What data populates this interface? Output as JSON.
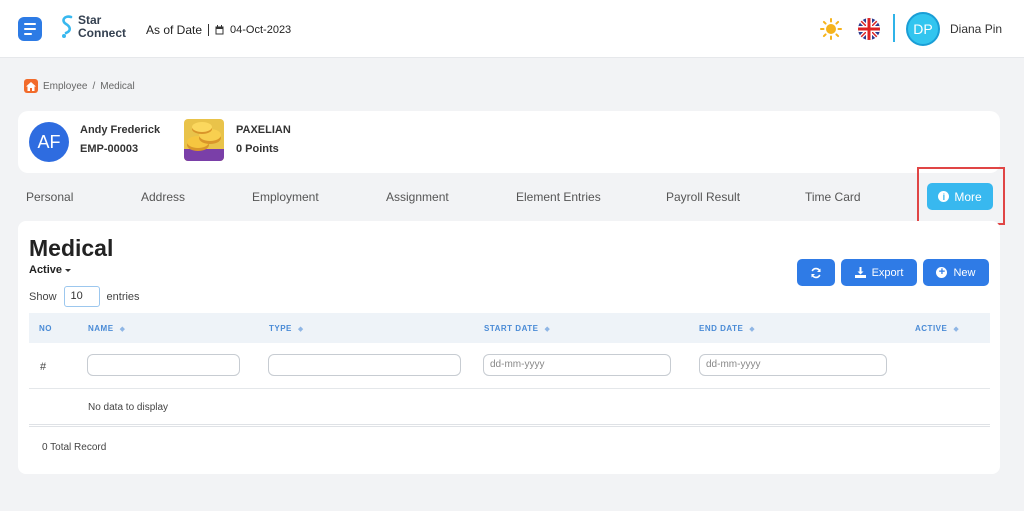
{
  "header": {
    "logo_line1": "Star",
    "logo_line2": "Connect",
    "as_of_label": "As of Date",
    "as_of_date": "04-Oct-2023",
    "user_initials": "DP",
    "user_name": "Diana Pin"
  },
  "breadcrumb": {
    "root": "Employee",
    "separator": "/",
    "current": "Medical"
  },
  "profile": {
    "initials": "AF",
    "name": "Andy Frederick",
    "employee_id": "EMP-00003",
    "reward_name": "PAXELIAN",
    "reward_points": "0 Points"
  },
  "tabs": [
    {
      "label": "Personal"
    },
    {
      "label": "Address"
    },
    {
      "label": "Employment"
    },
    {
      "label": "Assignment"
    },
    {
      "label": "Element Entries"
    },
    {
      "label": "Payroll Result"
    },
    {
      "label": "Time Card"
    }
  ],
  "more_button": {
    "label": "More"
  },
  "main": {
    "title": "Medical",
    "status": "Active",
    "show_label": "Show",
    "entries_value": "10",
    "entries_label": "entries",
    "export_label": "Export",
    "new_label": "New",
    "columns": [
      {
        "label": "NO"
      },
      {
        "label": "NAME"
      },
      {
        "label": "TYPE"
      },
      {
        "label": "START DATE"
      },
      {
        "label": "END DATE"
      },
      {
        "label": "ACTIVE"
      }
    ],
    "filter_hash": "#",
    "start_date_placeholder": "dd-mm-yyyy",
    "end_date_placeholder": "dd-mm-yyyy",
    "empty_text": "No data to display",
    "total_text": "0 Total Record"
  },
  "colors": {
    "primary": "#2f7be6",
    "accent": "#38b8ef",
    "highlight": "#e04545"
  }
}
